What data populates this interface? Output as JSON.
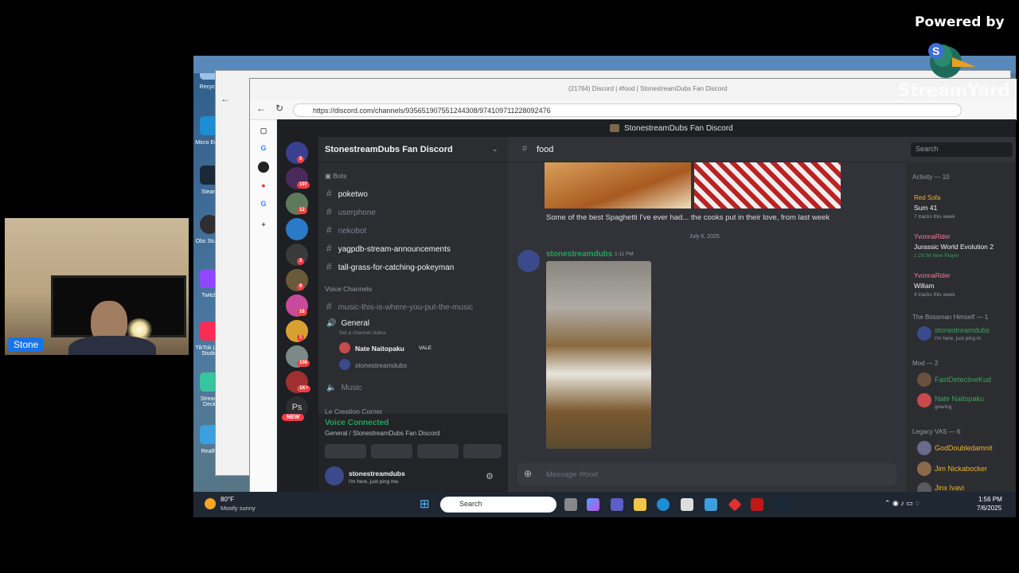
{
  "overlay": {
    "powered_by": "Powered by",
    "brand": "StreamYard"
  },
  "webcam": {
    "name_tag": "Stone"
  },
  "desktop_icons": [
    "Recycle",
    "Micro Edge",
    "Steam",
    "Obs Studio",
    "Twitch",
    "TikTok Live Studio",
    "Stream Deck",
    "RealPl"
  ],
  "browser": {
    "tab_title": "(21764) Discord | #food | StonestreamDubs Fan Discord",
    "url": "https://discord.com/channels/935651907551244308/974109711228092476"
  },
  "discord": {
    "window_title": "StonestreamDubs Fan Discord",
    "server_name": "StonestreamDubs Fan Discord",
    "server_badges": [
      "5",
      "197",
      "12",
      "",
      "2",
      "9",
      "16",
      "1",
      "108",
      "1K+",
      "Ps",
      "NEW"
    ],
    "categories": {
      "bots": "Bots",
      "voice": "Voice Channels",
      "creation": "Le Creation Corner"
    },
    "text_channels": [
      {
        "name": "poketwo",
        "active": true
      },
      {
        "name": "userphone",
        "active": false
      },
      {
        "name": "nekobot",
        "active": false
      },
      {
        "name": "yagpdb-stream-announcements",
        "active": true
      },
      {
        "name": "tall-grass-for-catching-pokeyman",
        "active": true
      }
    ],
    "voice_channels": {
      "music_text": "music-this-is-where-you-put-the-music",
      "general": "General",
      "general_status": "Set a channel status",
      "users": [
        {
          "name": "Nate Naitopaku",
          "tag": "VALE"
        },
        {
          "name": "stonestreamdubs",
          "tag": ""
        }
      ],
      "music": "Music"
    },
    "voice_connected": {
      "title": "Voice Connected",
      "sub": "General / StonestreamDubs Fan Discord"
    },
    "user_panel": {
      "name": "stonestreamdubs",
      "status": "I'm here, just ping me."
    },
    "channel": {
      "name": "food",
      "search_placeholder": "Search"
    },
    "messages": {
      "caption": "Some of the best Spaghetti I've ever had... the cooks put in their love, from last week",
      "date_divider": "July 6, 2025",
      "author": "stonestreamdubs",
      "time": "1:11 PM"
    },
    "composer_placeholder": "Message #food",
    "members": {
      "activity_header": "Activity — 10",
      "activities": [
        {
          "user": "Red Sofa",
          "title": "Sum 41",
          "sub": "7 tracks this week",
          "color": "#f0b232"
        },
        {
          "user": "YvonnaRider",
          "title": "Jurassic World Evolution 2",
          "sub": "1:29:56  New Player",
          "color": "#f47b9a"
        },
        {
          "user": "YvonnaRider",
          "title": "Willam",
          "sub": "4 tracks this week",
          "color": "#f47b9a"
        }
      ],
      "groups": [
        {
          "header": "The Bossman Himself — 1",
          "members": [
            {
              "name": "stonestreamdubs",
              "sub": "I'm here, just ping m",
              "color": "#3ba55c"
            }
          ]
        },
        {
          "header": "Mod — 2",
          "members": [
            {
              "name": "FastDetectiveKud",
              "sub": "",
              "color": "#3ba55c"
            },
            {
              "name": "Nate Naitopaku",
              "sub": "graving",
              "color": "#3ba55c"
            }
          ]
        },
        {
          "header": "Legacy VAS — 6",
          "members": [
            {
              "name": "GodDoubledamnit",
              "sub": "",
              "color": "#f0b232"
            },
            {
              "name": "Jim Nickabocker",
              "sub": "",
              "color": "#f0b232"
            },
            {
              "name": "Jinx Ivavi",
              "sub": "",
              "color": "#f0b232"
            }
          ]
        }
      ]
    }
  },
  "taskbar": {
    "weather_temp": "80°F",
    "weather_desc": "Mostly sunny",
    "search_label": "Search",
    "time": "1:56 PM",
    "date": "7/6/2025"
  },
  "colors": {
    "discord_bg": "#313338",
    "discord_sidebar": "#2b2d31",
    "discord_dark": "#1e1f22",
    "green": "#23a55a",
    "link": "#00a8fc",
    "taskbar": "#1f2733"
  }
}
